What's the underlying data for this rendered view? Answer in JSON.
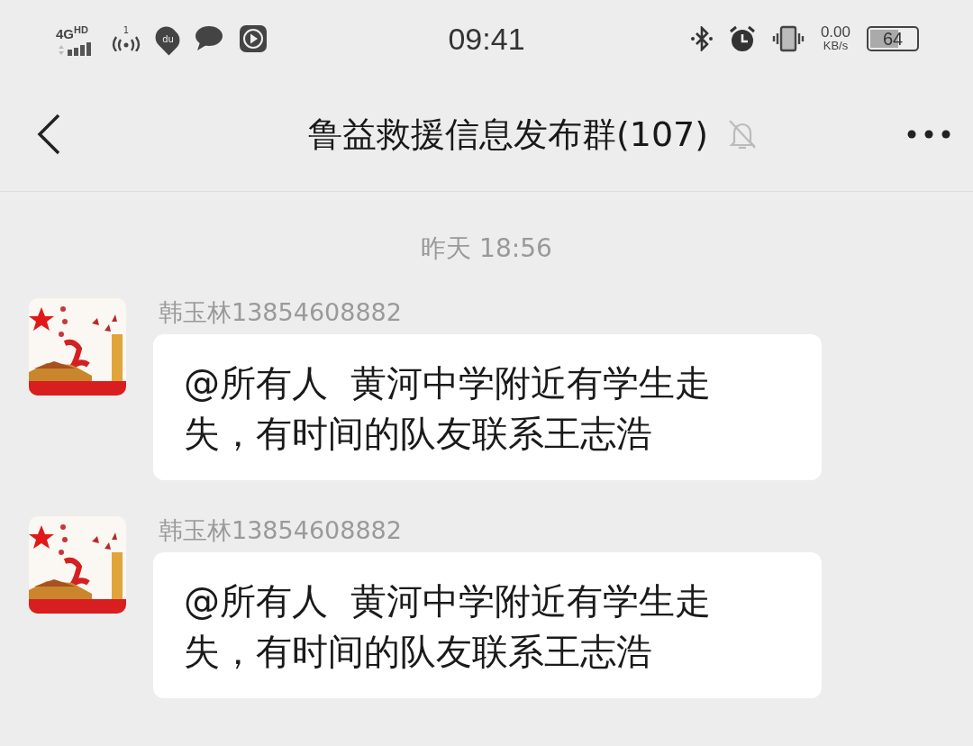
{
  "status_bar": {
    "network": "4G",
    "network_badge": "HD",
    "hotspot_count": "1",
    "map_pin_label": "du",
    "time": "09:41",
    "speed_value": "0.00",
    "speed_unit": "KB/s",
    "battery": "64"
  },
  "header": {
    "title": "鲁益救援信息发布群(107)",
    "muted": true
  },
  "timestamp": "昨天 18:56",
  "messages": [
    {
      "sender": "韩玉林13854608882",
      "text": "@所有人  黄河中学附近有学生走失，有时间的队友联系王志浩"
    },
    {
      "sender": "韩玉林13854608882",
      "text": "@所有人  黄河中学附近有学生走失，有时间的队友联系王志浩"
    }
  ]
}
